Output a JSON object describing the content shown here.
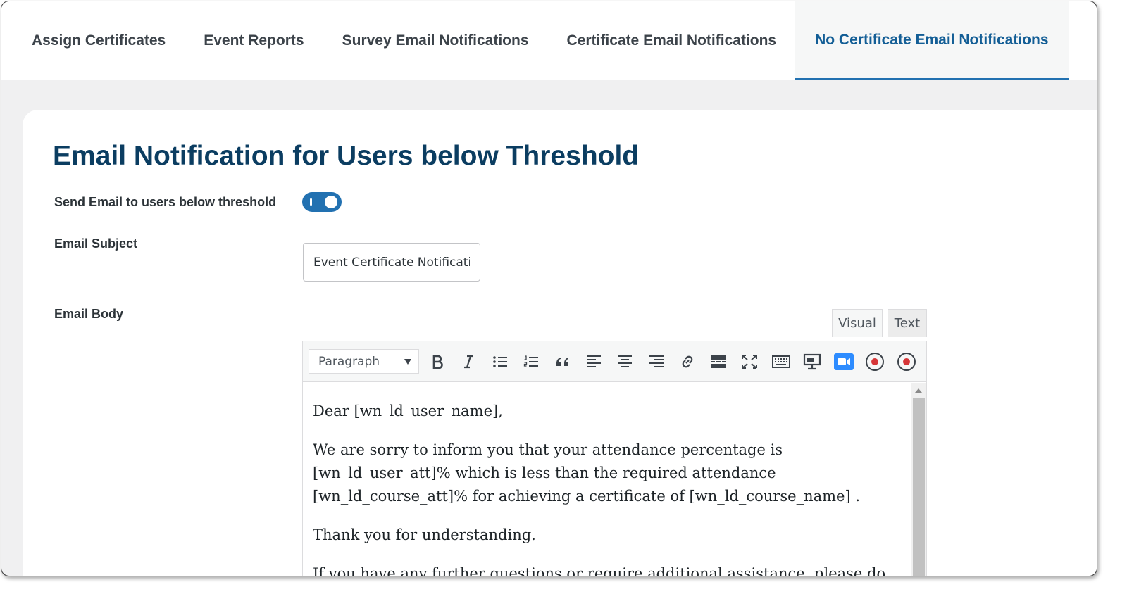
{
  "tabs": [
    {
      "label": "Assign Certificates",
      "active": false
    },
    {
      "label": "Event Reports",
      "active": false
    },
    {
      "label": "Survey Email Notifications",
      "active": false
    },
    {
      "label": "Certificate Email Notifications",
      "active": false
    },
    {
      "label": "No Certificate Email Notifications",
      "active": true
    }
  ],
  "page": {
    "title": "Email Notification for Users below Threshold"
  },
  "form": {
    "send_email_label": "Send Email to users below threshold",
    "send_email_enabled": true,
    "subject_label": "Email Subject",
    "subject_value": "Event Certificate Notification",
    "body_label": "Email Body"
  },
  "editor": {
    "mode_visual": "Visual",
    "mode_text": "Text",
    "format_value": "Paragraph",
    "toolbar_icons": [
      "bold-icon",
      "italic-icon",
      "bulleted-list-icon",
      "numbered-list-icon",
      "blockquote-icon",
      "align-left-icon",
      "align-center-icon",
      "align-right-icon",
      "link-icon",
      "read-more-icon",
      "fullscreen-icon",
      "toolbar-toggle-icon",
      "screen-share-icon",
      "zoom-icon",
      "record-icon",
      "record-alt-icon"
    ],
    "paragraphs": [
      "Dear [wn_ld_user_name],",
      "We are sorry to inform you that your attendance percentage is [wn_ld_user_att]% which is less than the required attendance [wn_ld_course_att]% for achieving a certificate of [wn_ld_course_name] .",
      "Thank you for understanding.",
      "If you have any further questions or require additional assistance, please do not"
    ]
  },
  "colors": {
    "accent": "#2271b1",
    "title": "#0b3d61",
    "active_tab_text": "#135e96"
  }
}
